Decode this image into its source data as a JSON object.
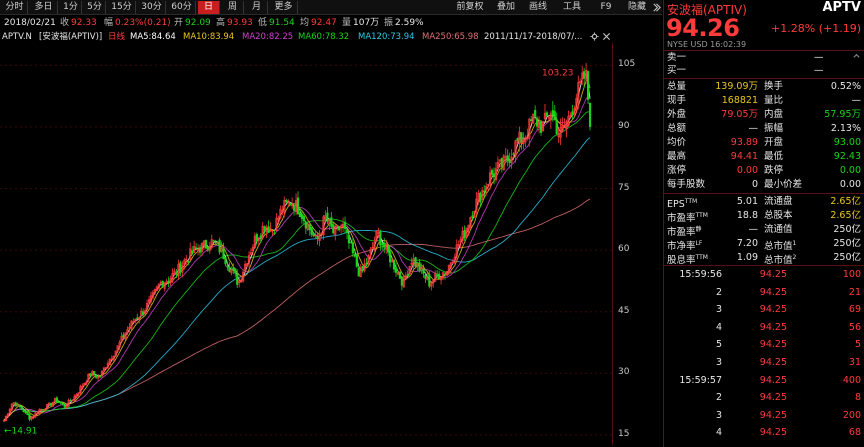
{
  "toolbar": {
    "periods": [
      "分时",
      "多日",
      "1分",
      "5分",
      "15分",
      "30分",
      "60分",
      "日",
      "周",
      "月",
      "更多"
    ],
    "active_period": "日",
    "right_buttons": [
      "前复权",
      "叠加",
      "画线",
      "工具"
    ],
    "f9_label": "F9",
    "hide_label": "隐藏"
  },
  "quote_strip": {
    "date": "2018/02/21",
    "close_label": "收",
    "close_value": "92.33",
    "change_pct_label": "幅",
    "change_pct_value": "0.23%(0.21)",
    "open_label": "开",
    "open_value": "92.09",
    "high_label": "高",
    "high_value": "93.93",
    "low_label": "低",
    "low_value": "91.54",
    "avg_label": "均",
    "avg_value": "92.47",
    "volume_label": "量",
    "volume_value": "107万",
    "amplitude_label": "振",
    "amplitude_value": "2.59%"
  },
  "ma_legend": {
    "symbol": "APTV.N",
    "name": "[安波福(APTIV)]",
    "period": "日线",
    "ma5": "MA5:84.64",
    "ma10": "MA10:83.94",
    "ma20": "MA20:82.25",
    "ma60": "MA60:78.32",
    "ma120": "MA120:73.94",
    "ma250": "MA250:65.98",
    "range": "2011/11/17-2018/07/..."
  },
  "chart_data": {
    "type": "candlestick",
    "ylim": [
      14,
      108
    ],
    "y_ticks": [
      "105",
      "90",
      "75",
      "60",
      "45",
      "30",
      "15"
    ],
    "max_label": "103.23",
    "min_label": "14.91",
    "colors": {
      "up": "#ff3b3b",
      "down": "#19d419",
      "ma5": "#ffffff",
      "ma10": "#e8c81c",
      "ma20": "#d040d0",
      "ma60": "#19d419",
      "ma120": "#2ec8e8",
      "ma250": "#e07070"
    },
    "close_path": [
      [
        0,
        18.5
      ],
      [
        4,
        23
      ],
      [
        8,
        21.5
      ],
      [
        12,
        19
      ],
      [
        16,
        21
      ],
      [
        20,
        22
      ],
      [
        24,
        23.5
      ],
      [
        28,
        22
      ],
      [
        32,
        24
      ],
      [
        36,
        27
      ],
      [
        40,
        30
      ],
      [
        44,
        29
      ],
      [
        48,
        33
      ],
      [
        52,
        36
      ],
      [
        56,
        40
      ],
      [
        60,
        43
      ],
      [
        64,
        45
      ],
      [
        68,
        48
      ],
      [
        72,
        52
      ],
      [
        76,
        53
      ],
      [
        80,
        55
      ],
      [
        84,
        58
      ],
      [
        88,
        60
      ],
      [
        92,
        61
      ],
      [
        96,
        62
      ],
      [
        100,
        60
      ],
      [
        104,
        56
      ],
      [
        108,
        52
      ],
      [
        112,
        58
      ],
      [
        116,
        63
      ],
      [
        120,
        66
      ],
      [
        124,
        65
      ],
      [
        128,
        70
      ],
      [
        132,
        72
      ],
      [
        136,
        70
      ],
      [
        140,
        66
      ],
      [
        144,
        62
      ],
      [
        148,
        68
      ],
      [
        152,
        64
      ],
      [
        156,
        66
      ],
      [
        160,
        60
      ],
      [
        164,
        54
      ],
      [
        168,
        58
      ],
      [
        172,
        64
      ],
      [
        176,
        60
      ],
      [
        180,
        56
      ],
      [
        184,
        52
      ],
      [
        188,
        58
      ],
      [
        192,
        55
      ],
      [
        196,
        52
      ],
      [
        200,
        54
      ],
      [
        204,
        55
      ],
      [
        208,
        60
      ],
      [
        212,
        64
      ],
      [
        216,
        70
      ],
      [
        220,
        74
      ],
      [
        224,
        78
      ],
      [
        228,
        80
      ],
      [
        232,
        82
      ],
      [
        236,
        86
      ],
      [
        240,
        88
      ],
      [
        244,
        92
      ],
      [
        248,
        90
      ],
      [
        252,
        94
      ],
      [
        256,
        88
      ],
      [
        260,
        92
      ],
      [
        264,
        98
      ],
      [
        268,
        103
      ],
      [
        270,
        92
      ]
    ]
  },
  "panel": {
    "stock_name": "安波福(APTIV)",
    "stock_code": "APTV",
    "last_price": "94.26",
    "change_text": "+1.28% (+1.19)",
    "exchange_line": "NYSE  USD    16:02:39",
    "sell1_label": "卖一",
    "sell1_value": "—",
    "buy1_label": "买一",
    "buy1_value": "—",
    "stats": [
      {
        "l1": "总量",
        "v1": "139.09万",
        "c1": "yellow",
        "l2": "换手",
        "v2": "0.52%",
        "c2": "white"
      },
      {
        "l1": "现手",
        "v1": "168821",
        "c1": "yellow",
        "l2": "量比",
        "v2": "—",
        "c2": "white"
      },
      {
        "l1": "外盘",
        "v1": "79.05万",
        "c1": "red",
        "l2": "内盘",
        "v2": "57.95万",
        "c2": "green"
      },
      {
        "l1": "总额",
        "v1": "—",
        "c1": "white",
        "l2": "振幅",
        "v2": "2.13%",
        "c2": "white"
      },
      {
        "l1": "均价",
        "v1": "93.89",
        "c1": "red",
        "l2": "开盘",
        "v2": "93.00",
        "c2": "green"
      },
      {
        "l1": "最高",
        "v1": "94.41",
        "c1": "red",
        "l2": "最低",
        "v2": "92.43",
        "c2": "green"
      },
      {
        "l1": "涨停",
        "v1": "0.00",
        "c1": "red",
        "l2": "跌停",
        "v2": "0.00",
        "c2": "green"
      },
      {
        "l1": "每手股数",
        "v1": "0",
        "c1": "white",
        "l2": "最小价差",
        "v2": "0.00",
        "c2": "white"
      }
    ],
    "fundamentals": [
      {
        "l1": "EPS",
        "s1": "TTM",
        "v1": "5.01",
        "l2": "流通盘",
        "v2": "2.65亿",
        "c2": "yellow"
      },
      {
        "l1": "市盈率",
        "s1": "TTM",
        "v1": "18.8",
        "l2": "总股本",
        "v2": "2.65亿",
        "c2": "yellow"
      },
      {
        "l1": "市盈率",
        "s1": "静",
        "v1": "—",
        "l2": "流通值",
        "v2": "250亿",
        "c2": "white"
      },
      {
        "l1": "市净率",
        "s1": "LF",
        "v1": "7.20",
        "l2": "总市值",
        "s2": "1",
        "v2": "250亿",
        "c2": "white"
      },
      {
        "l1": "股息率",
        "s1": "TTM",
        "v1": "1.09",
        "l2": "总市值",
        "s2": "2",
        "v2": "250亿",
        "c2": "white"
      }
    ],
    "ticks": [
      {
        "time": "15:59:56",
        "price": "94.25",
        "vol": "100"
      },
      {
        "time": "2",
        "price": "94.25",
        "vol": "21"
      },
      {
        "time": "3",
        "price": "94.25",
        "vol": "69"
      },
      {
        "time": "4",
        "price": "94.25",
        "vol": "56"
      },
      {
        "time": "5",
        "price": "94.25",
        "vol": "5"
      },
      {
        "time": "3",
        "price": "94.25",
        "vol": "31"
      },
      {
        "time": "15:59:57",
        "price": "94.25",
        "vol": "400"
      },
      {
        "time": "2",
        "price": "94.25",
        "vol": "8"
      },
      {
        "time": "3",
        "price": "94.25",
        "vol": "200"
      },
      {
        "time": "4",
        "price": "94.25",
        "vol": "68"
      }
    ]
  }
}
